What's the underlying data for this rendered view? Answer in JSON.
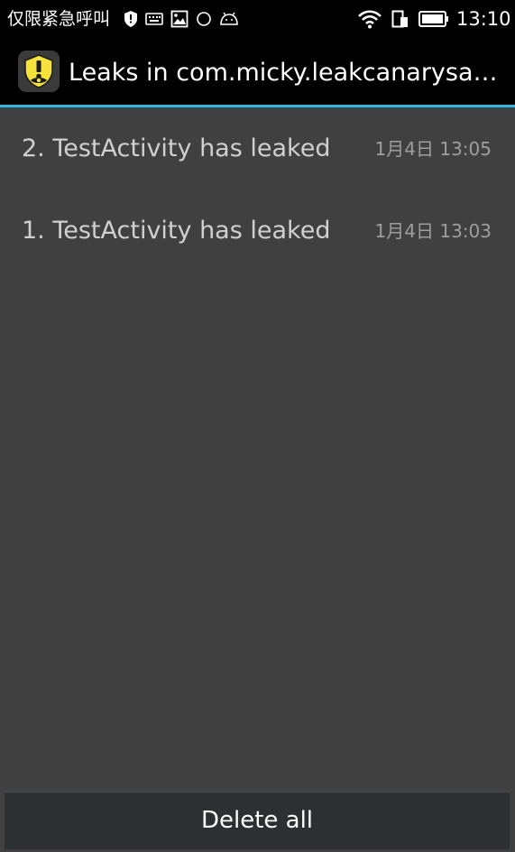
{
  "status_bar": {
    "carrier": "仅限紧急呼叫",
    "time": "13:10",
    "icons_left": [
      "shield-icon",
      "keyboard-icon",
      "image-icon",
      "circle-icon",
      "android-icon"
    ],
    "icons_right": [
      "wifi-icon",
      "sim-icon",
      "battery-icon"
    ]
  },
  "action_bar": {
    "title": "Leaks in com.micky.leakcanarysample",
    "icon": "leakcanary-app-icon",
    "accent_color": "#33b5e5"
  },
  "leaks": [
    {
      "title": "2. TestActivity has leaked",
      "time": "1月4日 13:05"
    },
    {
      "title": "1. TestActivity has leaked",
      "time": "1月4日 13:03"
    }
  ],
  "footer": {
    "delete_all_label": "Delete all"
  }
}
